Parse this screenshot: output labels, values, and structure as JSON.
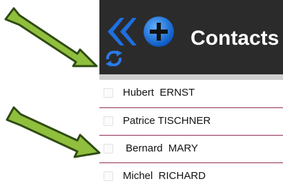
{
  "header": {
    "title": "Contacts",
    "background": "#2b2b2b",
    "back_icon": "double-chevron-left-icon",
    "add_icon": "add-circle-icon",
    "refresh_icon": "refresh-icon"
  },
  "contacts": [
    {
      "name": "Hubert  ERNST"
    },
    {
      "name": "Patrice TISCHNER"
    },
    {
      "name": " Bernard  MARY"
    },
    {
      "name": "Michel  RICHARD"
    }
  ],
  "colors": {
    "accent_blue": "#1e6fe0",
    "row_divider": "#8f2b55",
    "arrow_green": "#8fbf3c",
    "arrow_outline": "#2f4a14"
  }
}
